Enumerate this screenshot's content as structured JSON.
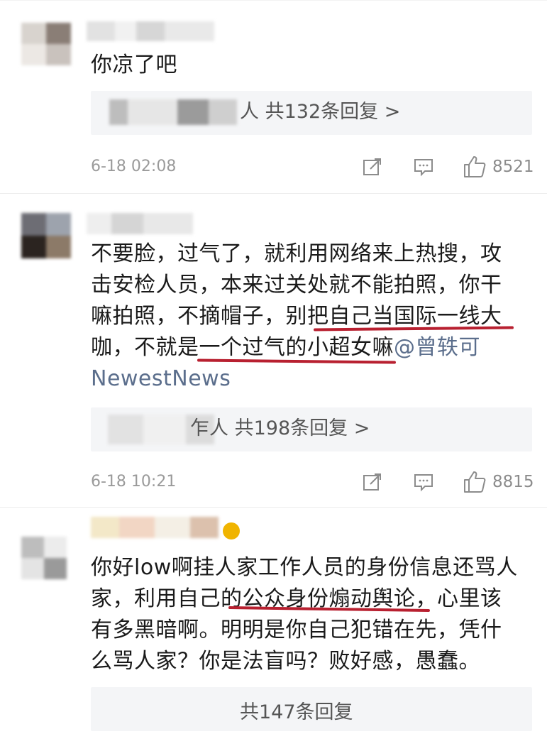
{
  "comments": [
    {
      "text": "你凉了吧",
      "replies": "人 共132条回复 >",
      "time": "6-18 02:08",
      "likes": "8521"
    },
    {
      "text_lines": [
        "不要脸，过气了，就利用网络来上热搜，攻",
        "击安检人员，本来过关处就不能拍照，你干",
        "嘛拍照，不摘帽子，别把自己当国际一线大",
        "咖，不就是一个过气的小超女嘛",
        "NewestNews"
      ],
      "mention": "@曾轶可",
      "replies": "乍人 共198条回复 >",
      "time": "6-18 10:21",
      "likes": "8815"
    },
    {
      "text_lines": [
        "你好low啊挂人家工作人员的身份信息还骂人",
        "家，利用自己的公众身份煽动舆论，心里该",
        "有多黑暗啊。明明是你自己犯错在先，凭什",
        "么骂人家？你是法盲吗？败好感，愚蠢。"
      ],
      "replies": "共147条回复"
    }
  ],
  "icons": [
    "forward-icon",
    "comment-icon",
    "like-icon"
  ],
  "accent": "#b82030"
}
